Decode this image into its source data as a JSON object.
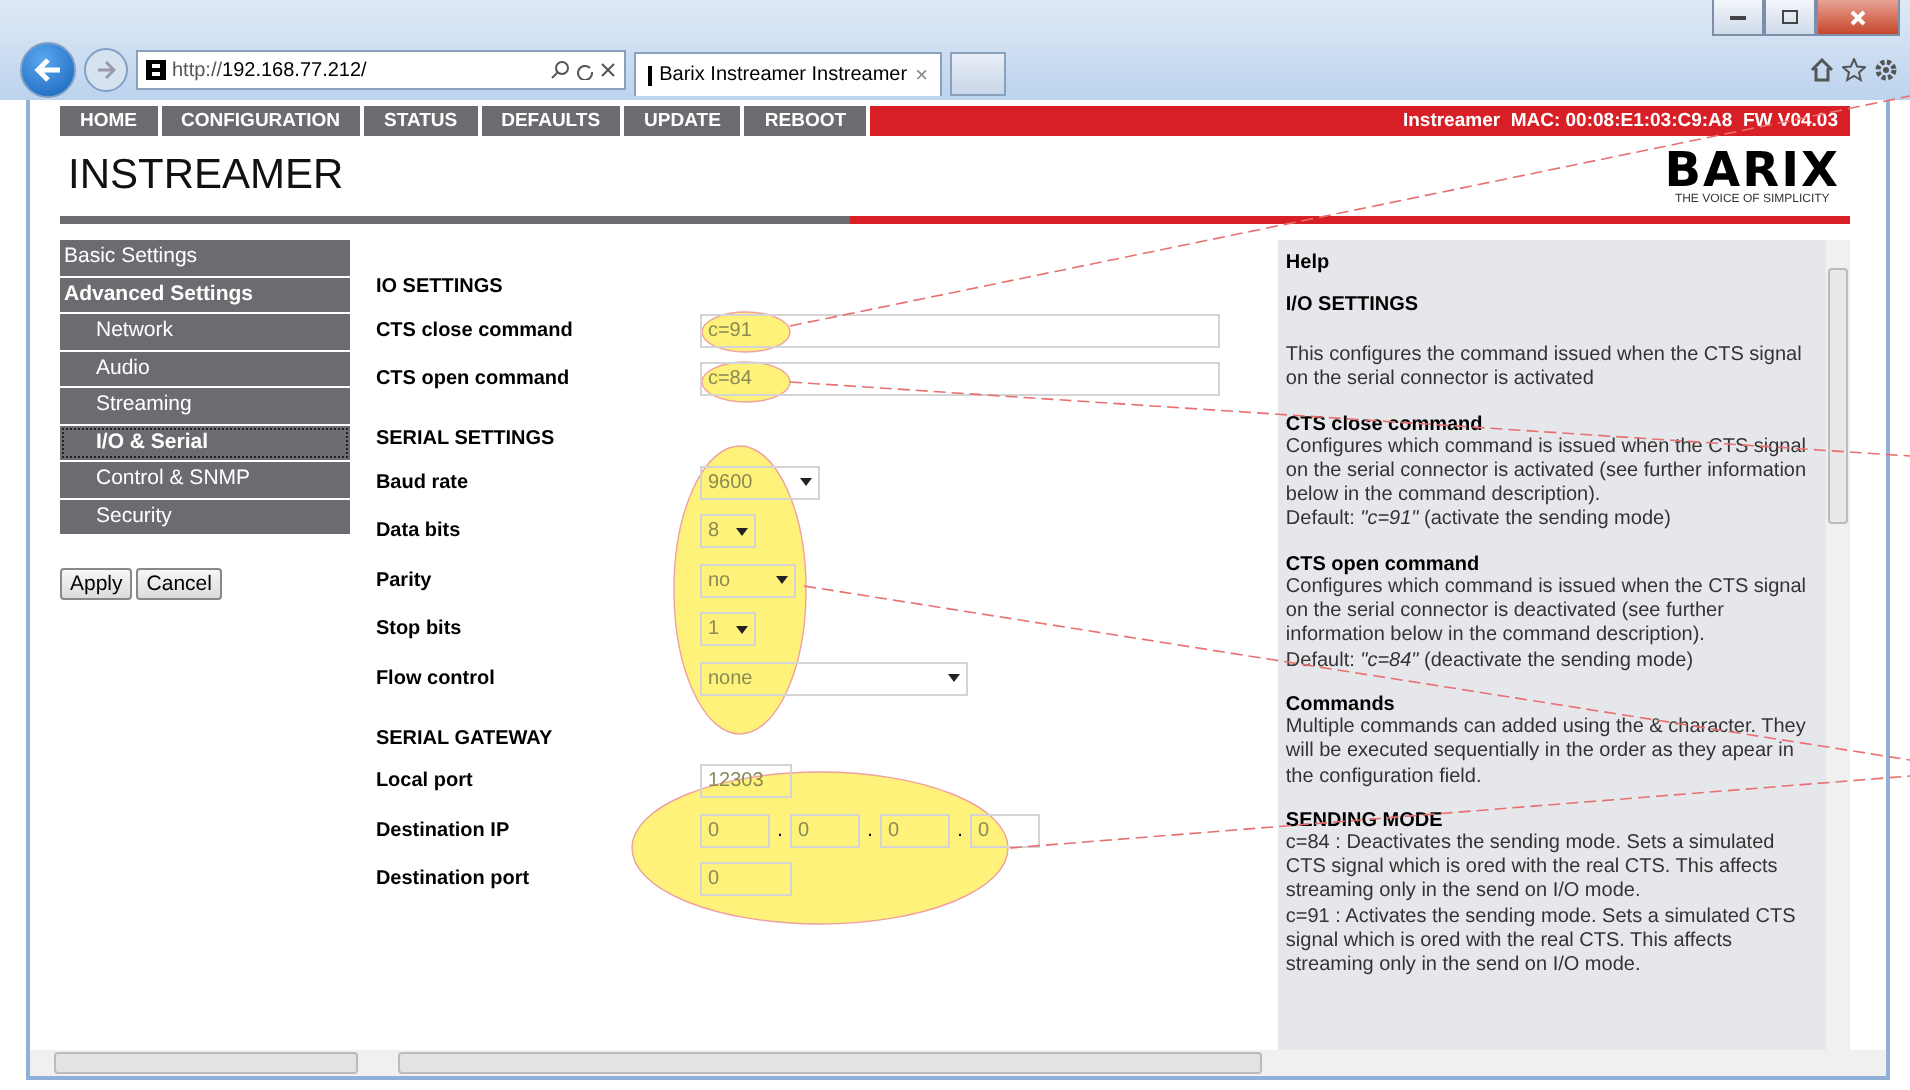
{
  "browser": {
    "url_prefix": "http://",
    "url_host": "192.168.77.212/",
    "tab_title": "Barix Instreamer Instreamer",
    "tab_close": "×"
  },
  "nav": {
    "items": [
      "HOME",
      "CONFIGURATION",
      "STATUS",
      "DEFAULTS",
      "UPDATE",
      "REBOOT"
    ],
    "info": "Instreamer  MAC: 00:08:E1:03:C9:A8  FW V04.03"
  },
  "header": {
    "title": "INSTREAMER",
    "logo": "BARIX",
    "tagline": "THE VOICE OF SIMPLICITY"
  },
  "sidebar": {
    "items": [
      {
        "label": "Basic Settings",
        "kind": "section",
        "selected": false
      },
      {
        "label": "Advanced Settings",
        "kind": "section",
        "selected": false
      },
      {
        "label": "Network",
        "kind": "sub",
        "selected": false
      },
      {
        "label": "Audio",
        "kind": "sub",
        "selected": false
      },
      {
        "label": "Streaming",
        "kind": "sub",
        "selected": false
      },
      {
        "label": "I/O & Serial",
        "kind": "sub",
        "selected": true
      },
      {
        "label": "Control & SNMP",
        "kind": "sub",
        "selected": false
      },
      {
        "label": "Security",
        "kind": "sub",
        "selected": false
      }
    ],
    "buttons": [
      "Apply",
      "Cancel"
    ]
  },
  "form": [
    {
      "title": "IO SETTINGS",
      "rows": [
        {
          "label": "CTS close command",
          "kind": "text",
          "value": "c=91",
          "highlighted": true
        },
        {
          "label": "CTS open command",
          "kind": "text",
          "value": "c=84",
          "highlighted": true
        }
      ]
    },
    {
      "title": "SERIAL SETTINGS",
      "rows": [
        {
          "label": "Baud rate",
          "kind": "select",
          "value": "9600",
          "highlighted": true
        },
        {
          "label": "Data bits",
          "kind": "select",
          "value": "8",
          "highlighted": true
        },
        {
          "label": "Parity",
          "kind": "select",
          "value": "no",
          "highlighted": true
        },
        {
          "label": "Stop bits",
          "kind": "select",
          "value": "1",
          "highlighted": true
        },
        {
          "label": "Flow control",
          "kind": "select",
          "value": "none",
          "highlighted": true
        }
      ]
    },
    {
      "title": "SERIAL GATEWAY",
      "rows": [
        {
          "label": "Local port",
          "kind": "text",
          "value": "12303",
          "highlighted": true
        },
        {
          "label": "Destination IP",
          "kind": "ip",
          "parts": [
            "0",
            "0",
            "0",
            "0"
          ],
          "separator": ".",
          "highlighted": true
        },
        {
          "label": "Destination port",
          "kind": "text",
          "value": "0",
          "highlighted": true
        }
      ]
    }
  ],
  "help": {
    "heading": "Help",
    "sections": [
      {
        "title": "I/O SETTINGS",
        "kind": "heading",
        "text": "This configures the command issued when the CTS signal on the serial connector is activated"
      },
      {
        "title": "CTS close command",
        "kind": "topic",
        "text": "Configures which command is issued when the CTS signal on the serial connector is activated (see further information below in the command description).\nDefault: *\"c=91\"* (activate the sending mode)"
      },
      {
        "title": "CTS open command",
        "kind": "topic",
        "text": "Configures which command is issued when the CTS signal on the serial connector is deactivated (see further information below in the command description).\nDefault: *\"c=84\"* (deactivate the sending mode)"
      },
      {
        "title": "Commands",
        "kind": "topic",
        "text": "Multiple commands can added using the & character. They will be executed sequentially in the order as they apear in the configuration field."
      },
      {
        "title": "SENDING MODE",
        "kind": "topic",
        "text": "c=84 : Deactivates the sending mode. Sets a simulated CTS signal which is ored with the real CTS. This affects streaming only in the send on I/O mode.\nc=91 : Activates the sending mode. Sets a simulated CTS signal which is ored with the real CTS. This affects streaming only in the send on I/O mode."
      }
    ]
  }
}
